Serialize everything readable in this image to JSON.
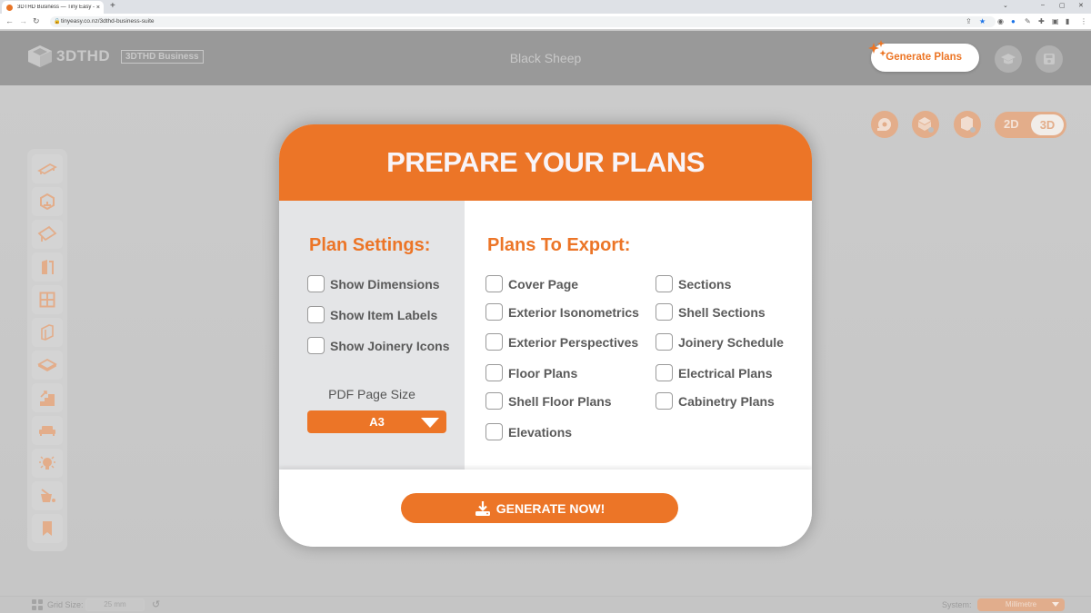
{
  "browser": {
    "tab_title": "3DTHD Business — Tiny Easy - T",
    "tab_close": "×",
    "new_tab": "+",
    "url": "tinyeasy.co.nz/3dthd-business-suite",
    "window_controls": {
      "dropdown": "⌄",
      "minimize": "–",
      "maximize": "▢",
      "close": "✕"
    }
  },
  "header": {
    "logo_text": "3DTHD",
    "edition_badge": "3DTHD Business",
    "project_title": "Black Sheep",
    "generate_plans_label": "Generate Plans",
    "icons": [
      "graduation-cap-icon",
      "save-icon"
    ]
  },
  "view_controls": {
    "icons": [
      "measure-tape-icon",
      "room-view-icon",
      "wall-view-icon"
    ],
    "toggle_2d": "2D",
    "toggle_3d": "3D",
    "active_mode": "3D"
  },
  "sidebar": {
    "items": [
      {
        "name": "floor-platform-icon"
      },
      {
        "name": "cube-icon"
      },
      {
        "name": "roof-icon"
      },
      {
        "name": "door-icon"
      },
      {
        "name": "window-icon"
      },
      {
        "name": "wall-panel-icon"
      },
      {
        "name": "floor-layer-icon"
      },
      {
        "name": "stairs-icon"
      },
      {
        "name": "sofa-icon"
      },
      {
        "name": "lightbulb-icon"
      },
      {
        "name": "paint-bucket-icon"
      },
      {
        "name": "bookmark-icon"
      }
    ]
  },
  "footer": {
    "grid_size_label": "Grid Size:",
    "grid_size_value": "25 mm",
    "system_label": "System:",
    "system_value": "Millimetre"
  },
  "modal": {
    "title": "PREPARE YOUR PLANS",
    "plan_settings": {
      "heading": "Plan Settings:",
      "options": [
        {
          "label": "Show Dimensions",
          "checked": false
        },
        {
          "label": "Show Item Labels",
          "checked": false
        },
        {
          "label": "Show Joinery Icons",
          "checked": false
        }
      ],
      "pdf_page_size_label": "PDF Page Size",
      "pdf_page_size_value": "A3"
    },
    "plans_to_export": {
      "heading": "Plans To Export:",
      "column1": [
        {
          "label": "Cover Page",
          "checked": false
        },
        {
          "label": "Exterior Isonometrics",
          "checked": false
        },
        {
          "label": "Exterior Perspectives",
          "checked": false
        },
        {
          "label": "Floor Plans",
          "checked": false
        },
        {
          "label": "Shell Floor Plans",
          "checked": false
        },
        {
          "label": "Elevations",
          "checked": false
        }
      ],
      "column2": [
        {
          "label": "Sections",
          "checked": false
        },
        {
          "label": "Shell Sections",
          "checked": false
        },
        {
          "label": "Joinery Schedule",
          "checked": false
        },
        {
          "label": "Electrical Plans",
          "checked": false
        },
        {
          "label": "Cabinetry Plans",
          "checked": false
        }
      ]
    },
    "generate_button": "GENERATE NOW!"
  },
  "colors": {
    "accent": "#ec7527",
    "header_bg": "#999999",
    "left_panel_bg": "#e4e5e7",
    "text": "#5a5a5a"
  }
}
